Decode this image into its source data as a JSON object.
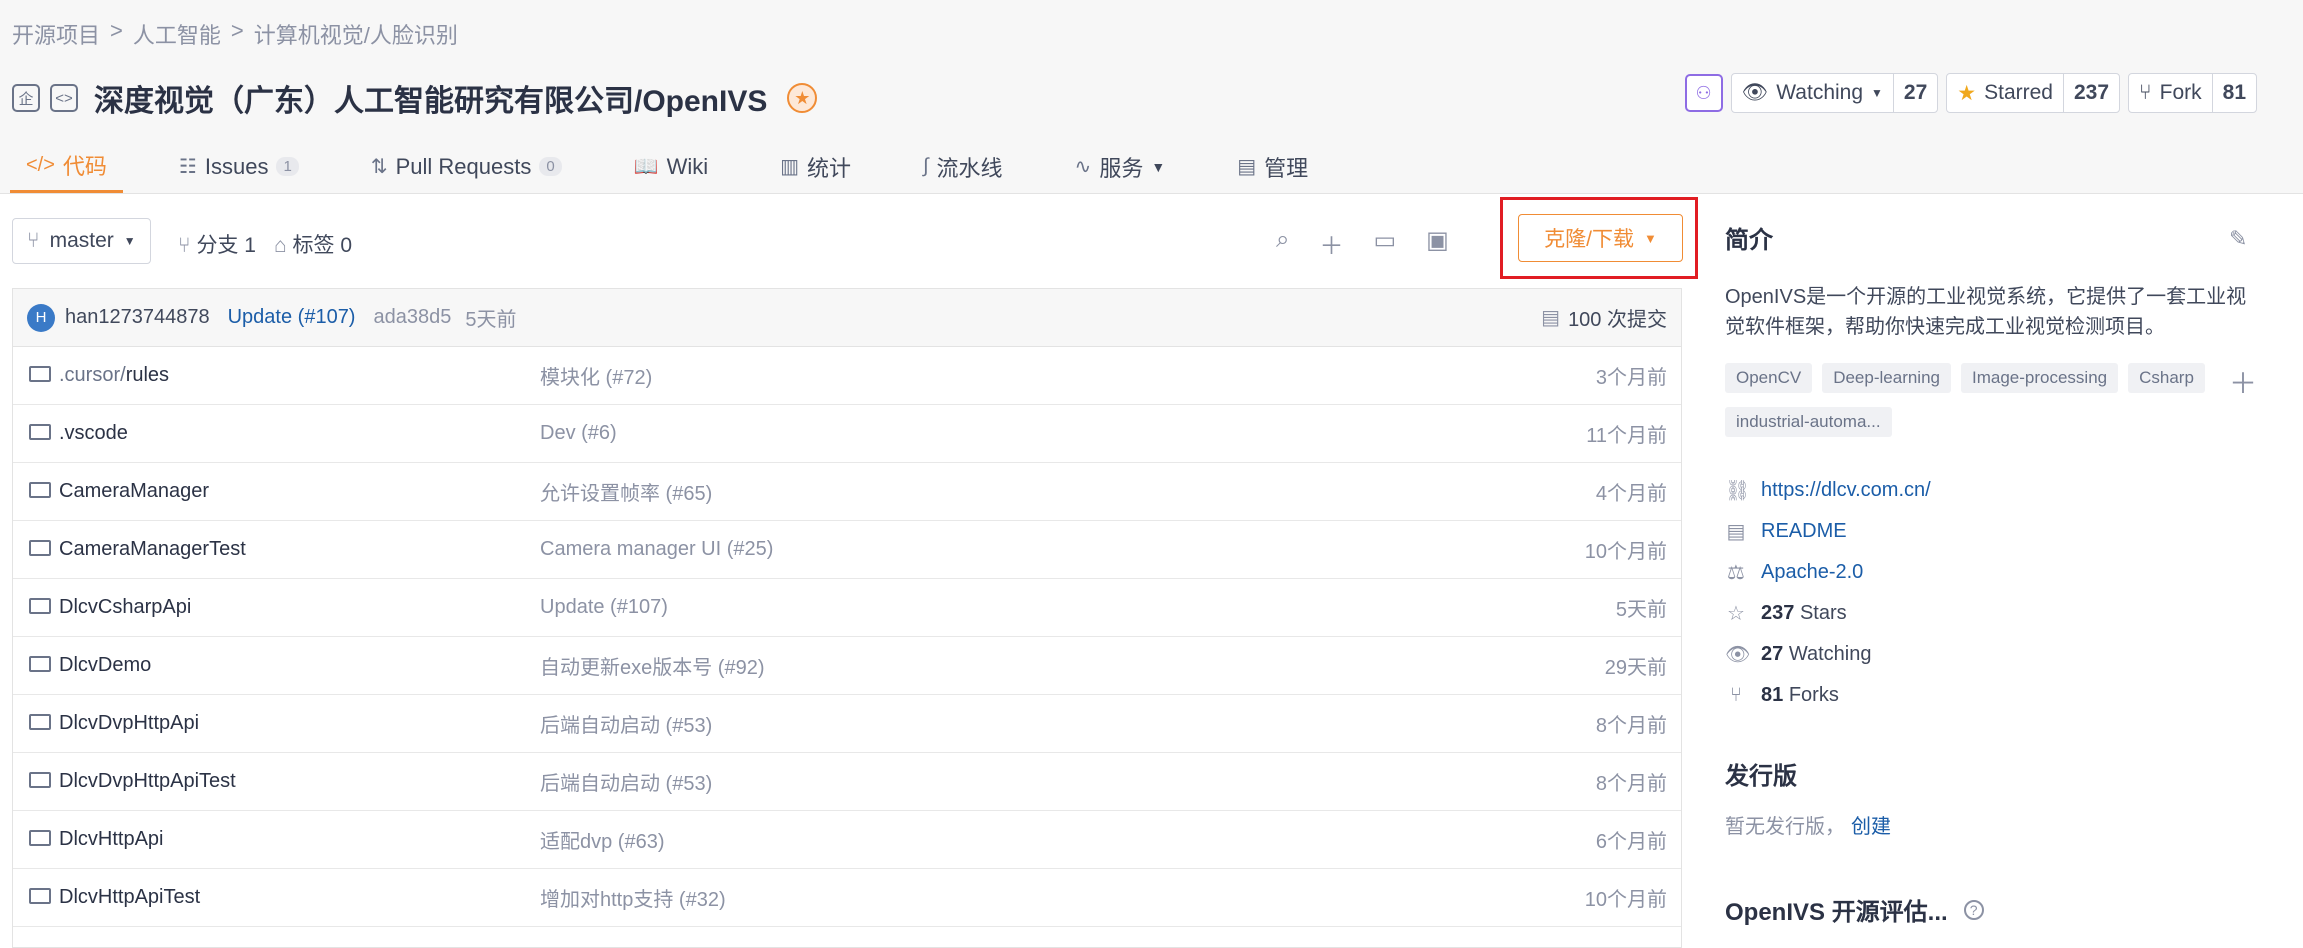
{
  "breadcrumb": [
    "开源项目",
    "人工智能",
    "计算机视觉/人脸识别"
  ],
  "breadcrumb_sep": ">",
  "repo": {
    "name": "深度视觉（广东）人工智能研究有限公司/OpenIVS"
  },
  "stats": {
    "watch_label": "Watching",
    "watch_count": "27",
    "star_label": "Starred",
    "star_count": "237",
    "fork_label": "Fork",
    "fork_count": "81"
  },
  "tabs": [
    {
      "label": "代码",
      "count": ""
    },
    {
      "label": "Issues",
      "count": "1"
    },
    {
      "label": "Pull Requests",
      "count": "0"
    },
    {
      "label": "Wiki",
      "count": ""
    },
    {
      "label": "统计",
      "count": ""
    },
    {
      "label": "流水线",
      "count": ""
    },
    {
      "label": "服务",
      "count": ""
    },
    {
      "label": "管理",
      "count": ""
    }
  ],
  "toolbar": {
    "branch": "master",
    "branches": "分支 1",
    "tags": "标签 0",
    "clone_label": "克隆/下载"
  },
  "latest_commit": {
    "avatar_letter": "H",
    "author": "han1273744878",
    "message": "Update (#107)",
    "sha": "ada38d5",
    "time": "5天前",
    "total": "100 次提交"
  },
  "files": [
    {
      "name_dim": ".cursor/",
      "name": "rules",
      "message": "模块化 (#72)",
      "time": "3个月前"
    },
    {
      "name_dim": "",
      "name": ".vscode",
      "message": "Dev (#6)",
      "time": "11个月前"
    },
    {
      "name_dim": "",
      "name": "CameraManager",
      "message": "允许设置帧率 (#65)",
      "time": "4个月前"
    },
    {
      "name_dim": "",
      "name": "CameraManagerTest",
      "message": "Camera manager UI (#25)",
      "time": "10个月前"
    },
    {
      "name_dim": "",
      "name": "DlcvCsharpApi",
      "message": "Update (#107)",
      "time": "5天前"
    },
    {
      "name_dim": "",
      "name": "DlcvDemo",
      "message": "自动更新exe版本号 (#92)",
      "time": "29天前"
    },
    {
      "name_dim": "",
      "name": "DlcvDvpHttpApi",
      "message": "后端自动启动 (#53)",
      "time": "8个月前"
    },
    {
      "name_dim": "",
      "name": "DlcvDvpHttpApiTest",
      "message": "后端自动启动 (#53)",
      "time": "8个月前"
    },
    {
      "name_dim": "",
      "name": "DlcvHttpApi",
      "message": "适配dvp (#63)",
      "time": "6个月前"
    },
    {
      "name_dim": "",
      "name": "DlcvHttpApiTest",
      "message": "增加对http支持 (#32)",
      "time": "10个月前"
    }
  ],
  "sidebar": {
    "intro_title": "简介",
    "description": "OpenIVS是一个开源的工业视觉系统，它提供了一套工业视觉软件框架，帮助你快速完成工业视觉检测项目。",
    "tags": [
      "OpenCV",
      "Deep-learning",
      "Image-processing",
      "Csharp",
      "industrial-automa..."
    ],
    "website": "https://dlcv.com.cn/",
    "readme": "README",
    "license": "Apache-2.0",
    "stars_num": "237",
    "stars_label": "Stars",
    "watching_num": "27",
    "watching_label": "Watching",
    "forks_num": "81",
    "forks_label": "Forks",
    "release_title": "发行版",
    "release_text": "暂无发行版，",
    "release_link": "创建",
    "eval_title": "OpenIVS 开源评估..."
  },
  "colors": {
    "accent": "#f08c35",
    "link": "#1b5da8",
    "highlight": "#e11d23"
  }
}
